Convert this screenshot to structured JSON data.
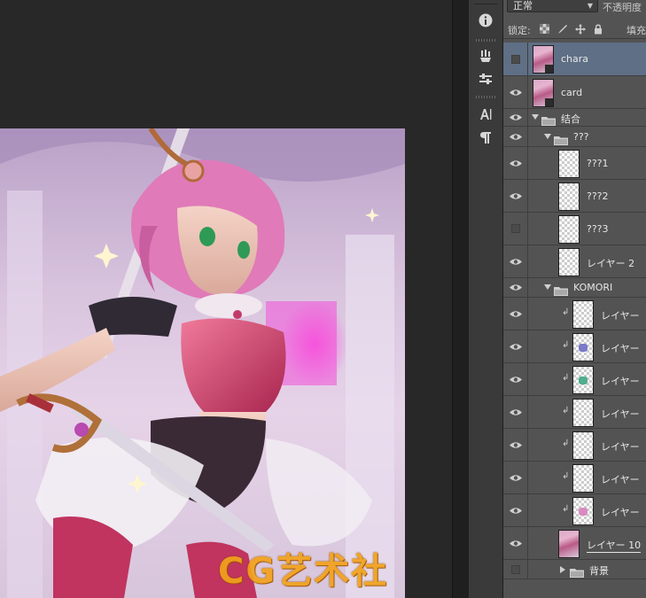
{
  "options_bar": {
    "blend_mode": "正常",
    "opacity_label": "不透明度",
    "lock_label": "锁定:",
    "fill_label": "填充"
  },
  "icons": {
    "tools": [
      "info-icon",
      "brush-preset-icon",
      "adjustment-sliders-icon",
      "character-icon",
      "paragraph-icon"
    ],
    "lock": [
      "lock-transparent-pixels-icon",
      "lock-image-pixels-icon",
      "lock-position-icon",
      "lock-all-icon"
    ]
  },
  "layers": [
    {
      "name": "chara",
      "visible": false,
      "selected": true,
      "kind": "art"
    },
    {
      "name": "card",
      "visible": true,
      "kind": "art"
    },
    {
      "name": "结合",
      "visible": true,
      "kind": "group",
      "expanded": true
    },
    {
      "name": "???",
      "visible": true,
      "kind": "group",
      "expanded": true
    },
    {
      "name": "???1",
      "visible": true,
      "kind": "pixel"
    },
    {
      "name": "???2",
      "visible": true,
      "kind": "pixel"
    },
    {
      "name": "???3",
      "visible": false,
      "kind": "pixel"
    },
    {
      "name": "レイヤー 2",
      "visible": true,
      "kind": "pixel"
    },
    {
      "name": "KOMORI",
      "visible": true,
      "kind": "group",
      "expanded": true
    },
    {
      "name": "レイヤー",
      "visible": true,
      "kind": "clipped"
    },
    {
      "name": "レイヤー",
      "visible": true,
      "kind": "clipped",
      "mark": "#7a7ac8"
    },
    {
      "name": "レイヤー",
      "visible": true,
      "kind": "clipped",
      "mark": "#4fae8e"
    },
    {
      "name": "レイヤー",
      "visible": true,
      "kind": "clipped"
    },
    {
      "name": "レイヤー",
      "visible": true,
      "kind": "clipped"
    },
    {
      "name": "レイヤー",
      "visible": true,
      "kind": "clipped"
    },
    {
      "name": "レイヤー",
      "visible": true,
      "kind": "clipped",
      "mark": "#d98ac0"
    },
    {
      "name": "レイヤー 10",
      "visible": true,
      "kind": "art-linked"
    },
    {
      "name": "背景",
      "visible": false,
      "kind": "group",
      "expanded": false
    }
  ],
  "watermark": "CG艺术社"
}
